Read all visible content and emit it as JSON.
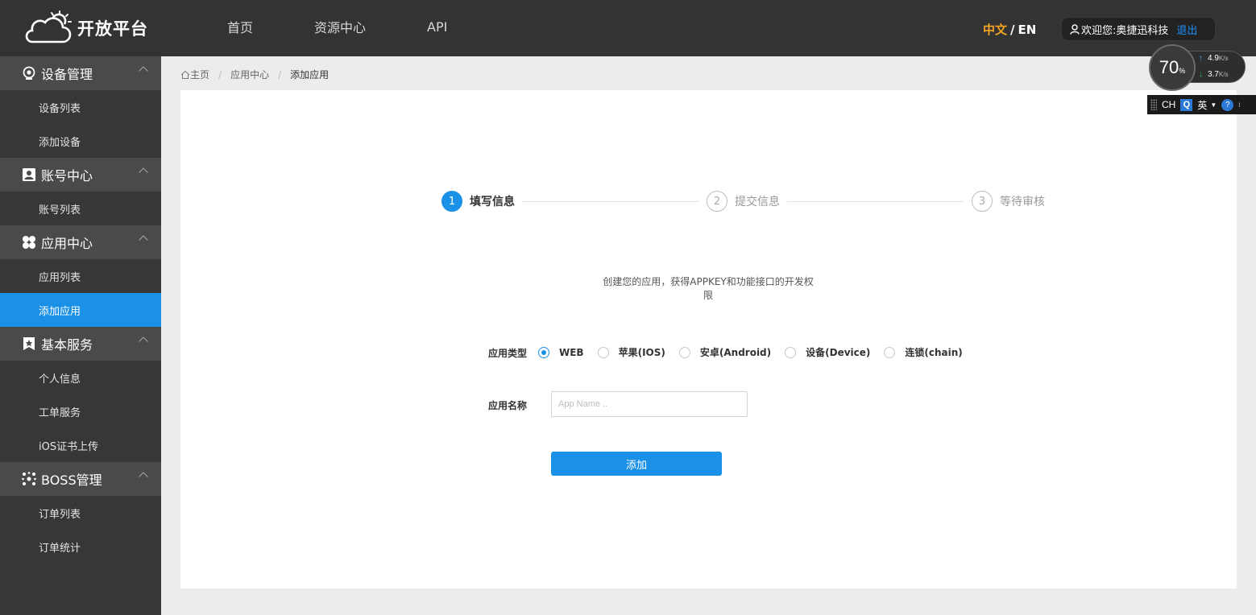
{
  "header": {
    "logo_text": "开放平台",
    "nav": [
      {
        "label": "首页"
      },
      {
        "label": "资源中心"
      },
      {
        "label": "API"
      }
    ],
    "lang_zh": "中文",
    "lang_sep": "/",
    "lang_en": "EN",
    "welcome": "欢迎您:奥捷迅科技",
    "logout": "退出"
  },
  "sidebar": {
    "groups": [
      {
        "title": "设备管理",
        "icon": "webcam-icon",
        "items": [
          {
            "label": "设备列表"
          },
          {
            "label": "添加设备"
          }
        ]
      },
      {
        "title": "账号中心",
        "icon": "account-icon",
        "items": [
          {
            "label": "账号列表"
          }
        ]
      },
      {
        "title": "应用中心",
        "icon": "apps-icon",
        "items": [
          {
            "label": "应用列表"
          },
          {
            "label": "添加应用"
          }
        ]
      },
      {
        "title": "基本服务",
        "icon": "bookmark-star-icon",
        "items": [
          {
            "label": "个人信息"
          },
          {
            "label": "工单服务"
          },
          {
            "label": "iOS证书上传"
          }
        ]
      },
      {
        "title": "BOSS管理",
        "icon": "network-icon",
        "items": [
          {
            "label": "订单列表"
          },
          {
            "label": "订单统计"
          }
        ]
      }
    ],
    "active_item": "添加应用"
  },
  "breadcrumb": {
    "home": "主页",
    "mid": "应用中心",
    "current": "添加应用",
    "sep": "/"
  },
  "steps": [
    {
      "num": "1",
      "label": "填写信息",
      "active": true
    },
    {
      "num": "2",
      "label": "提交信息",
      "active": false
    },
    {
      "num": "3",
      "label": "等待审核",
      "active": false
    }
  ],
  "description": "创建您的应用，获得APPKEY和功能接口的开发权限",
  "form": {
    "type_label": "应用类型",
    "types": [
      {
        "label": "WEB",
        "selected": true
      },
      {
        "label": "苹果(IOS)",
        "selected": false
      },
      {
        "label": "安卓(Android)",
        "selected": false
      },
      {
        "label": "设备(Device)",
        "selected": false
      },
      {
        "label": "连锁(chain)",
        "selected": false
      }
    ],
    "name_label": "应用名称",
    "name_placeholder": "App Name ..",
    "name_value": "",
    "submit_label": "添加"
  },
  "overlay": {
    "percent": "70",
    "percent_unit": "%",
    "upload": "4.9",
    "download": "3.7",
    "speed_unit": "K/s",
    "ime_mode": "CH",
    "ime_lang": "英"
  },
  "colors": {
    "header_bg": "#333333",
    "sidebar_bg": "#373737",
    "sidebar_group_bg": "#4a4a4a",
    "accent": "#1a90e6",
    "lang_active": "#f5a623",
    "logout": "#1e90ff"
  }
}
